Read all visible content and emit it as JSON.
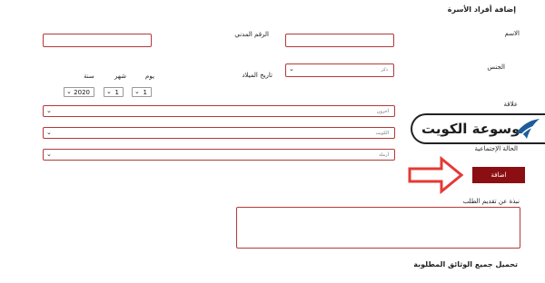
{
  "section_title": "إضافة أفراد الأسرة",
  "labels": {
    "name": "الاسم",
    "civil_id": "الرقم المدني",
    "gender": "الجنس",
    "birth_date": "تاريخ الميلاد",
    "relationship": "علاقة",
    "marital_status": "الحالة الإجتماعية",
    "request_note": "نبذة عن تقديم الطلب"
  },
  "date_headers": {
    "day": "يوم",
    "month": "شهر",
    "year": "سنة"
  },
  "gender_select": {
    "value": "ذكر"
  },
  "birth_date": {
    "day": "1",
    "month": "1",
    "year": "2020"
  },
  "relationship_select": {
    "value": "أخرون"
  },
  "country_select": {
    "value": "الكويت"
  },
  "marital_select": {
    "value": "أرملة"
  },
  "add_button_label": "اضافة",
  "watermark": {
    "text": "موسوعة الكويت"
  },
  "footer_title": "تحميل جميع الوثائق المطلوبة",
  "colors": {
    "accent": "#8b0f12",
    "border": "#b23a3a",
    "arrow": "#e53935"
  }
}
